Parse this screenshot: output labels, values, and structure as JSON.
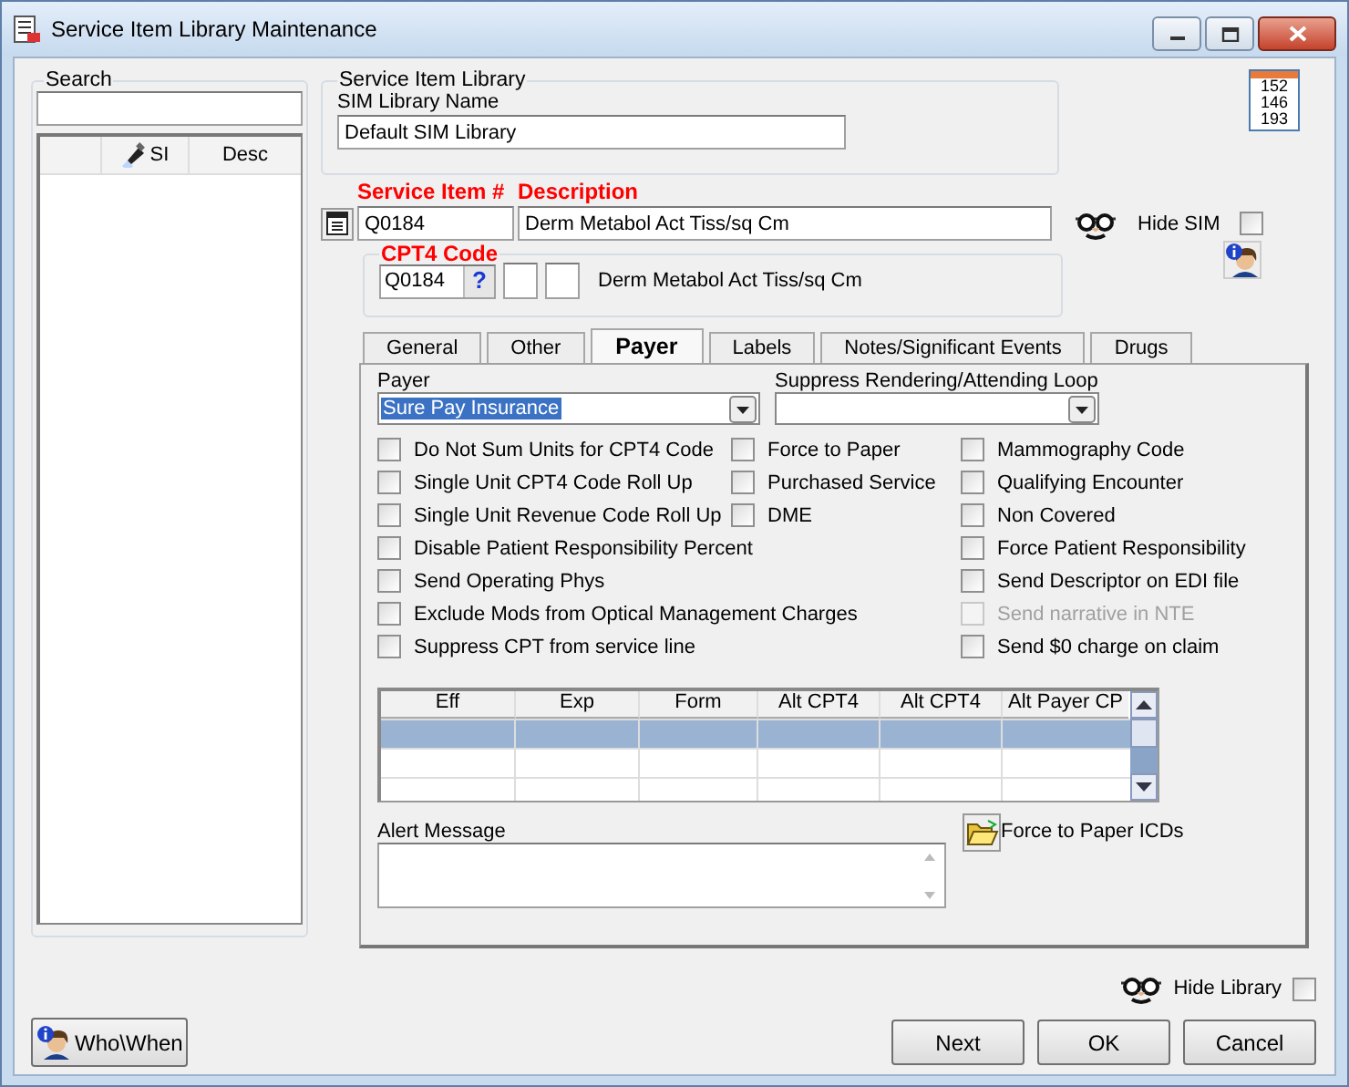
{
  "window": {
    "title": "Service Item Library Maintenance"
  },
  "search": {
    "label": "Search",
    "columns": [
      {
        "label": "SI",
        "kind": "flashlight"
      },
      {
        "label": "Desc",
        "kind": "plain"
      }
    ]
  },
  "library": {
    "group_title": "Service Item Library",
    "name_label": "SIM Library Name",
    "name_value": "Default SIM Library"
  },
  "report_icon": {
    "lines": [
      "152",
      "146",
      "193"
    ]
  },
  "service_item": {
    "number_label": "Service Item #",
    "description_label": "Description",
    "number": "Q0184",
    "description": "Derm Metabol Act Tiss/sq Cm",
    "hide_sim_label": "Hide SIM",
    "hide_sim_checked": false
  },
  "cpt4": {
    "title": "CPT4 Code",
    "code": "Q0184",
    "help": "?",
    "description": "Derm Metabol Act Tiss/sq Cm"
  },
  "tabs": [
    {
      "label": "General",
      "selected": false
    },
    {
      "label": "Other",
      "selected": false
    },
    {
      "label": "Payer",
      "selected": true
    },
    {
      "label": "Labels",
      "selected": false
    },
    {
      "label": "Notes/Significant Events",
      "selected": false
    },
    {
      "label": "Drugs",
      "selected": false
    }
  ],
  "payer": {
    "label": "Payer",
    "value": "Sure Pay Insurance",
    "suppress_label": "Suppress Rendering/Attending Loop"
  },
  "option_columns": [
    [
      {
        "label": "Do Not Sum Units for CPT4 Code",
        "checked": false,
        "disabled": false
      },
      {
        "label": "Single Unit CPT4 Code Roll Up",
        "checked": false,
        "disabled": false
      },
      {
        "label": "Single Unit Revenue Code Roll Up",
        "checked": false,
        "disabled": false
      },
      {
        "label": "Disable Patient Responsibility Percent",
        "checked": false,
        "disabled": false
      },
      {
        "label": "Send Operating Phys",
        "checked": false,
        "disabled": false
      },
      {
        "label": "Exclude Mods from Optical Management Charges",
        "checked": false,
        "disabled": false
      },
      {
        "label": "Suppress CPT from service line",
        "checked": false,
        "disabled": false
      }
    ],
    [
      {
        "label": "Force to Paper",
        "checked": false,
        "disabled": false
      },
      {
        "label": "Purchased Service",
        "checked": false,
        "disabled": false
      },
      {
        "label": "DME",
        "checked": false,
        "disabled": false
      }
    ],
    [
      {
        "label": "Mammography Code",
        "checked": false,
        "disabled": false
      },
      {
        "label": "Qualifying Encounter",
        "checked": false,
        "disabled": false
      },
      {
        "label": "Non Covered",
        "checked": false,
        "disabled": false
      },
      {
        "label": "Force Patient Responsibility",
        "checked": false,
        "disabled": false
      },
      {
        "label": "Send Descriptor on EDI file",
        "checked": false,
        "disabled": false
      },
      {
        "label": "Send narrative in NTE",
        "checked": false,
        "disabled": true
      },
      {
        "label": "Send $0 charge on claim",
        "checked": false,
        "disabled": false
      }
    ]
  ],
  "grid": {
    "columns": [
      "Eff",
      "Exp",
      "Form",
      "Alt CPT4",
      "Alt CPT4",
      "Alt Payer CP"
    ],
    "rows": [
      {
        "selected": true
      },
      {
        "selected": false
      },
      {
        "selected": false
      }
    ]
  },
  "alert": {
    "label": "Alert Message"
  },
  "force_icds": {
    "label": "Force to Paper ICDs"
  },
  "hide_library": {
    "label": "Hide Library",
    "checked": false
  },
  "buttons": [
    {
      "label": "Who\\When",
      "kind": "info"
    },
    {
      "label": "Next",
      "kind": "plain"
    },
    {
      "label": "OK",
      "kind": "plain"
    },
    {
      "label": "Cancel",
      "kind": "plain"
    }
  ]
}
